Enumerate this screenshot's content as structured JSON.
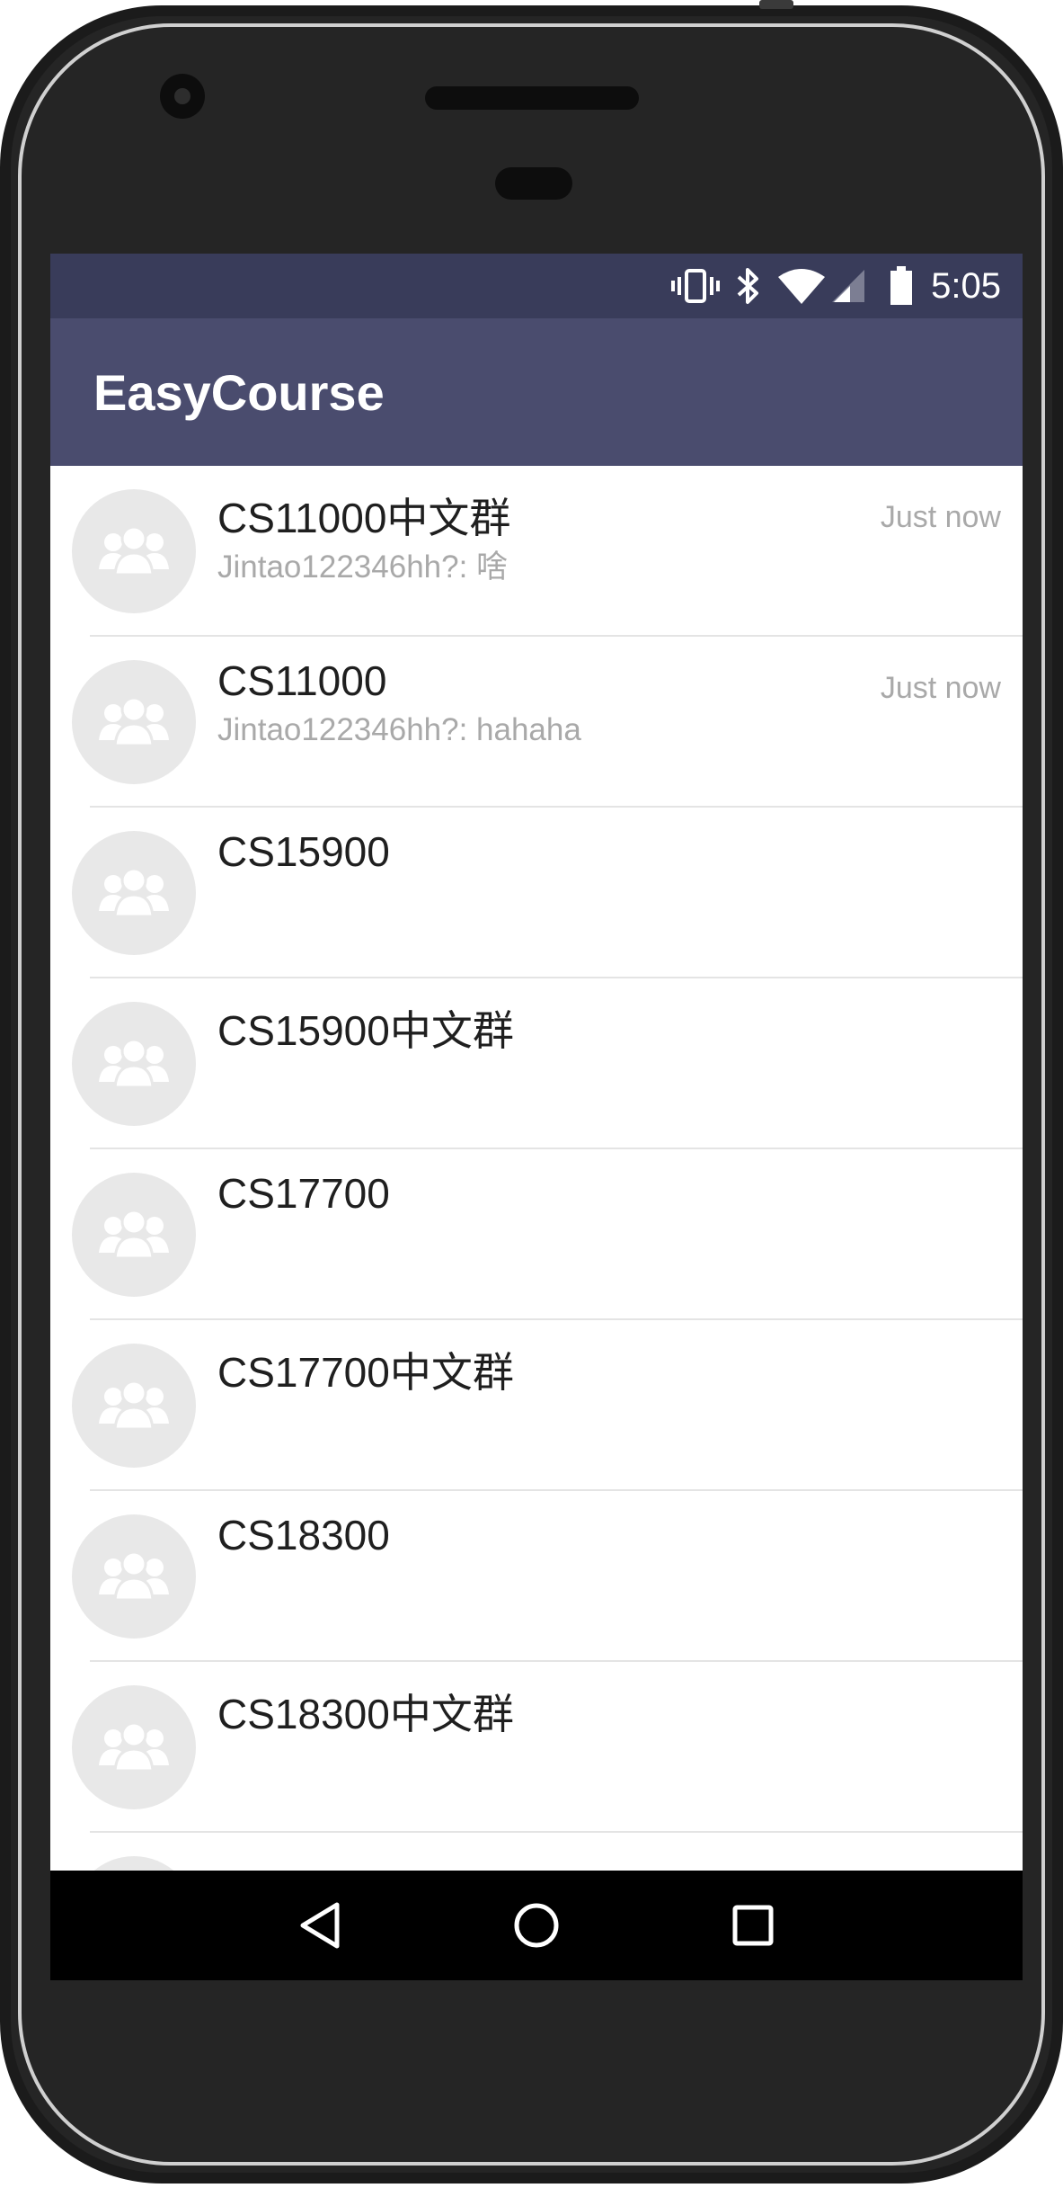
{
  "status_bar": {
    "time": "5:05",
    "icons": [
      "vibrate-icon",
      "bluetooth-icon",
      "wifi-icon",
      "signal-icon",
      "battery-icon"
    ]
  },
  "app_bar": {
    "title": "EasyCourse"
  },
  "chats": [
    {
      "name": "CS11000中文群",
      "last_message": "Jintao122346hh?: 啥",
      "time": "Just now"
    },
    {
      "name": "CS11000",
      "last_message": "Jintao122346hh?: hahaha",
      "time": "Just now"
    },
    {
      "name": "CS15900",
      "last_message": "",
      "time": ""
    },
    {
      "name": "CS15900中文群",
      "last_message": "",
      "time": ""
    },
    {
      "name": "CS17700",
      "last_message": "",
      "time": ""
    },
    {
      "name": "CS17700中文群",
      "last_message": "",
      "time": ""
    },
    {
      "name": "CS18300",
      "last_message": "",
      "time": ""
    },
    {
      "name": "CS18300中文群",
      "last_message": "",
      "time": ""
    }
  ],
  "nav_bar": {
    "icons": [
      "back-icon",
      "home-icon",
      "recents-icon"
    ]
  },
  "colors": {
    "status_bar": "#393c5a",
    "app_bar": "#4a4c6e",
    "avatar_bg": "#e8e8e8",
    "secondary_text": "#a9a9a9"
  }
}
